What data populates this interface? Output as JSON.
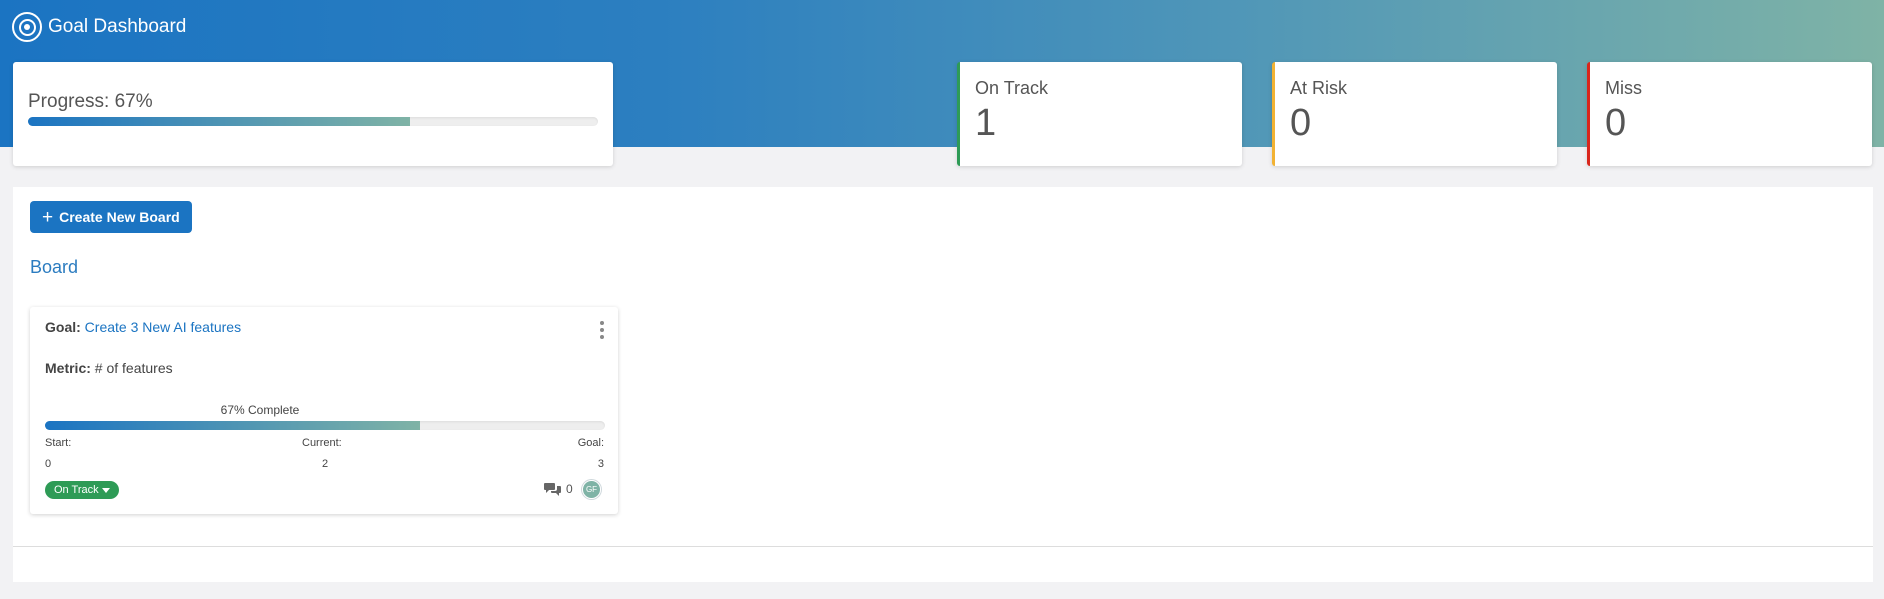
{
  "app": {
    "title": "Goal Dashboard",
    "logo_icon": "target-icon"
  },
  "colors": {
    "brand": "#1b74c2",
    "on_track": "#2e9b56",
    "at_risk": "#f2b233",
    "miss": "#d9261c"
  },
  "summary": {
    "progress_label": "Progress: 67%",
    "progress_value": 0.67
  },
  "stats": {
    "on_track": {
      "label": "On Track",
      "value": "1"
    },
    "at_risk": {
      "label": "At Risk",
      "value": "0"
    },
    "miss": {
      "label": "Miss",
      "value": "0"
    }
  },
  "actions": {
    "create_board_label": "Create New Board"
  },
  "board": {
    "title": "Board",
    "cards": [
      {
        "goal_label": "Goal:",
        "goal_text": "Create 3 New AI features",
        "metric_label": "Metric:",
        "metric_text": "# of features",
        "complete_label": "67% Complete",
        "progress_value": 0.67,
        "start_label": "Start:",
        "start_value": "0",
        "current_label": "Current:",
        "current_value": "2",
        "goal_value_label": "Goal:",
        "goal_value": "3",
        "status": "On Track",
        "comment_icon": "comments-icon",
        "comment_count": "0",
        "avatar_initials": "GF"
      }
    ]
  }
}
